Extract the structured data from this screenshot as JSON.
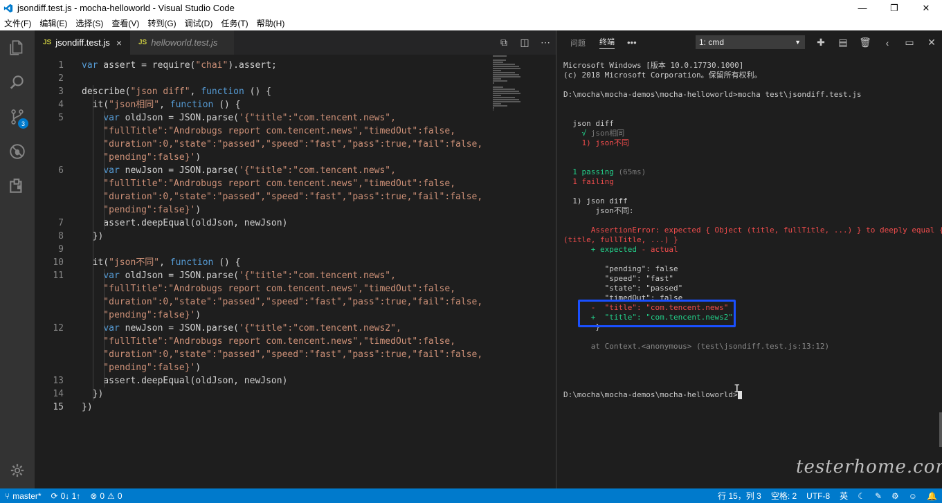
{
  "window": {
    "title": "jsondiff.test.js - mocha-helloworld - Visual Studio Code",
    "minimize": "—",
    "restore": "❐",
    "close": "✕"
  },
  "menu": [
    "文件(F)",
    "编辑(E)",
    "选择(S)",
    "查看(V)",
    "转到(G)",
    "调试(D)",
    "任务(T)",
    "帮助(H)"
  ],
  "activity": {
    "scm_badge": "3"
  },
  "tabs": [
    {
      "icon": "JS",
      "label": "jsondiff.test.js",
      "close": "×"
    },
    {
      "icon": "JS",
      "label": "helloworld.test.js"
    }
  ],
  "code": [
    {
      "n": "1",
      "segs": [
        [
          "kw",
          "var"
        ],
        [
          "t",
          " assert = require("
        ],
        [
          "str",
          "\"chai\""
        ],
        [
          "t",
          ").assert;"
        ]
      ]
    },
    {
      "n": "2",
      "segs": []
    },
    {
      "n": "3",
      "segs": [
        [
          "t",
          "describe("
        ],
        [
          "str",
          "\"json diff\""
        ],
        [
          "t",
          ", "
        ],
        [
          "kw",
          "function"
        ],
        [
          "t",
          " () {"
        ]
      ]
    },
    {
      "n": "4",
      "segs": [
        [
          "t",
          "  it("
        ],
        [
          "str",
          "\"json相同\""
        ],
        [
          "t",
          ", "
        ],
        [
          "kw",
          "function"
        ],
        [
          "t",
          " () {"
        ]
      ]
    },
    {
      "n": "5",
      "segs": [
        [
          "t",
          "    "
        ],
        [
          "kw",
          "var"
        ],
        [
          "t",
          " oldJson = JSON.parse("
        ],
        [
          "str",
          "'{\"title\":\"com.tencent.news\","
        ]
      ]
    },
    {
      "n": "",
      "segs": [
        [
          "str",
          "    \"fullTitle\":\"Androbugs report com.tencent.news\",\"timedOut\":false,"
        ]
      ]
    },
    {
      "n": "",
      "segs": [
        [
          "str",
          "    \"duration\":0,\"state\":\"passed\",\"speed\":\"fast\",\"pass\":true,\"fail\":false,"
        ]
      ]
    },
    {
      "n": "",
      "segs": [
        [
          "str",
          "    \"pending\":false}'"
        ],
        [
          "t",
          ")"
        ]
      ]
    },
    {
      "n": "6",
      "segs": [
        [
          "t",
          "    "
        ],
        [
          "kw",
          "var"
        ],
        [
          "t",
          " newJson = JSON.parse("
        ],
        [
          "str",
          "'{\"title\":\"com.tencent.news\","
        ]
      ]
    },
    {
      "n": "",
      "segs": [
        [
          "str",
          "    \"fullTitle\":\"Androbugs report com.tencent.news\",\"timedOut\":false,"
        ]
      ]
    },
    {
      "n": "",
      "segs": [
        [
          "str",
          "    \"duration\":0,\"state\":\"passed\",\"speed\":\"fast\",\"pass\":true,\"fail\":false,"
        ]
      ]
    },
    {
      "n": "",
      "segs": [
        [
          "str",
          "    \"pending\":false}'"
        ],
        [
          "t",
          ")"
        ]
      ]
    },
    {
      "n": "7",
      "segs": [
        [
          "t",
          "    assert.deepEqual(oldJson, newJson)"
        ]
      ]
    },
    {
      "n": "8",
      "segs": [
        [
          "t",
          "  })"
        ]
      ]
    },
    {
      "n": "9",
      "segs": []
    },
    {
      "n": "10",
      "segs": [
        [
          "t",
          "  it("
        ],
        [
          "str",
          "\"json不同\""
        ],
        [
          "t",
          ", "
        ],
        [
          "kw",
          "function"
        ],
        [
          "t",
          " () {"
        ]
      ]
    },
    {
      "n": "11",
      "segs": [
        [
          "t",
          "    "
        ],
        [
          "kw",
          "var"
        ],
        [
          "t",
          " oldJson = JSON.parse("
        ],
        [
          "str",
          "'{\"title\":\"com.tencent.news\","
        ]
      ]
    },
    {
      "n": "",
      "segs": [
        [
          "str",
          "    \"fullTitle\":\"Androbugs report com.tencent.news\",\"timedOut\":false,"
        ]
      ]
    },
    {
      "n": "",
      "segs": [
        [
          "str",
          "    \"duration\":0,\"state\":\"passed\",\"speed\":\"fast\",\"pass\":true,\"fail\":false,"
        ]
      ]
    },
    {
      "n": "",
      "segs": [
        [
          "str",
          "    \"pending\":false}'"
        ],
        [
          "t",
          ")"
        ]
      ]
    },
    {
      "n": "12",
      "segs": [
        [
          "t",
          "    "
        ],
        [
          "kw",
          "var"
        ],
        [
          "t",
          " newJson = JSON.parse("
        ],
        [
          "str",
          "'{\"title\":\"com.tencent.news2\","
        ]
      ]
    },
    {
      "n": "",
      "segs": [
        [
          "str",
          "    \"fullTitle\":\"Androbugs report com.tencent.news\",\"timedOut\":false,"
        ]
      ]
    },
    {
      "n": "",
      "segs": [
        [
          "str",
          "    \"duration\":0,\"state\":\"passed\",\"speed\":\"fast\",\"pass\":true,\"fail\":false,"
        ]
      ]
    },
    {
      "n": "",
      "segs": [
        [
          "str",
          "    \"pending\":false}'"
        ],
        [
          "t",
          ")"
        ]
      ]
    },
    {
      "n": "13",
      "segs": [
        [
          "t",
          "    assert.deepEqual(oldJson, newJson)"
        ]
      ]
    },
    {
      "n": "14",
      "segs": [
        [
          "t",
          "  })"
        ]
      ]
    },
    {
      "n": "15",
      "segs": [
        [
          "t",
          "})"
        ]
      ],
      "current": true
    }
  ],
  "panel": {
    "tab_problems": "问题",
    "tab_terminal": "终端",
    "more": "•••",
    "terminal_select": "1: cmd",
    "terminal_lines": [
      {
        "cls": "w",
        "text": "Microsoft Windows [版本 10.0.17730.1000]"
      },
      {
        "cls": "w",
        "text": "(c) 2018 Microsoft Corporation。保留所有权利。"
      },
      {
        "cls": "w",
        "text": ""
      },
      {
        "cls": "w",
        "text": "D:\\mocha\\mocha-demos\\mocha-helloworld>mocha test\\jsondiff.test.js"
      },
      {
        "cls": "w",
        "text": ""
      },
      {
        "cls": "w",
        "text": ""
      },
      {
        "cls": "w",
        "text": "  json diff"
      },
      {
        "cls": "mixed",
        "segs": [
          [
            "green",
            "    √ "
          ],
          [
            "dim",
            "json相同"
          ]
        ]
      },
      {
        "cls": "red",
        "text": "    1) json不同"
      },
      {
        "cls": "w",
        "text": ""
      },
      {
        "cls": "w",
        "text": ""
      },
      {
        "cls": "mixed",
        "segs": [
          [
            "green",
            "  1 passing "
          ],
          [
            "dim",
            "(65ms)"
          ]
        ]
      },
      {
        "cls": "red",
        "text": "  1 failing"
      },
      {
        "cls": "w",
        "text": ""
      },
      {
        "cls": "w",
        "text": "  1) json diff"
      },
      {
        "cls": "w",
        "text": "       json不同:"
      },
      {
        "cls": "w",
        "text": ""
      },
      {
        "cls": "red",
        "text": "      AssertionError: expected { Object (title, fullTitle, ...) } to deeply equal { Object"
      },
      {
        "cls": "red",
        "text": "(title, fullTitle, ...) }"
      },
      {
        "cls": "mixed",
        "segs": [
          [
            "green",
            "      + expected "
          ],
          [
            "red",
            "- actual"
          ]
        ]
      },
      {
        "cls": "w",
        "text": ""
      },
      {
        "cls": "w",
        "text": "         \"pending\": false"
      },
      {
        "cls": "w",
        "text": "         \"speed\": \"fast\""
      },
      {
        "cls": "w",
        "text": "         \"state\": \"passed\""
      },
      {
        "cls": "w",
        "text": "         \"timedOut\": false"
      },
      {
        "cls": "red",
        "text": "      -  \"title\": \"com.tencent.news\""
      },
      {
        "cls": "green",
        "text": "      +  \"title\": \"com.tencent.news2\""
      },
      {
        "cls": "w",
        "text": "       }"
      },
      {
        "cls": "w",
        "text": ""
      },
      {
        "cls": "gr",
        "text": "      at Context.<anonymous> (test\\jsondiff.test.js:13:12)"
      },
      {
        "cls": "w",
        "text": ""
      },
      {
        "cls": "w",
        "text": ""
      },
      {
        "cls": "w",
        "text": ""
      },
      {
        "cls": "w",
        "text": ""
      },
      {
        "cls": "prompt",
        "text": "D:\\mocha\\mocha-demos\\mocha-helloworld>"
      }
    ]
  },
  "status": {
    "branch": "master*",
    "sync": "0↓ 1↑",
    "errors": "0",
    "warnings": "0",
    "position": "行 15，列 3",
    "spaces": "空格: 2",
    "encoding": "UTF-8",
    "ime": "英"
  },
  "watermark": "testerhome.com",
  "colors": {
    "status_bar": "#007acc",
    "highlight_box": "#1a50ff",
    "keyword": "#569cd6",
    "string": "#ce9178",
    "test_pass": "#23d18b",
    "test_fail": "#f14c4c"
  }
}
